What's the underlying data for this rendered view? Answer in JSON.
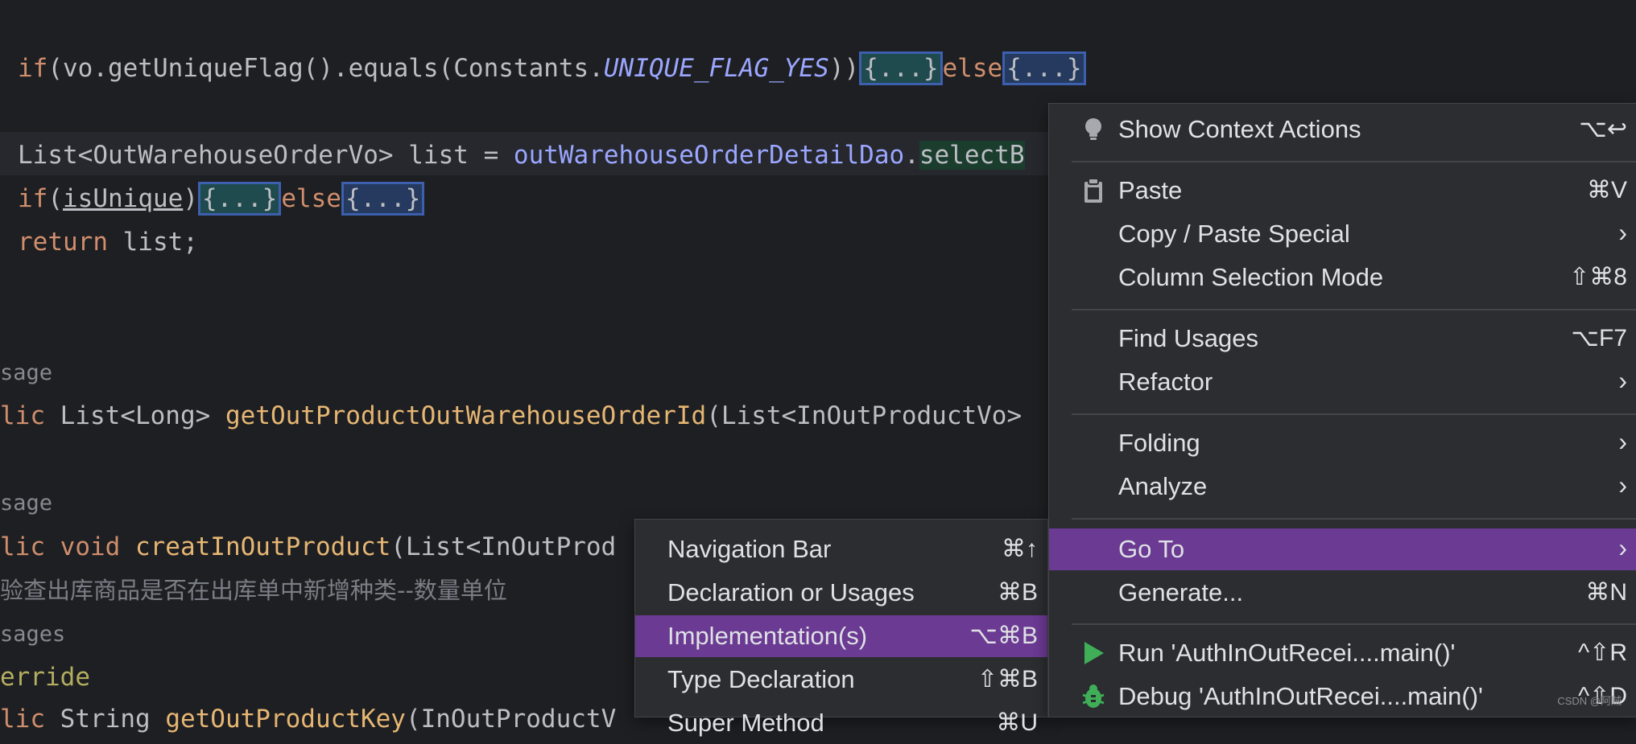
{
  "code": {
    "line1": {
      "if": "if",
      "a": "(vo.getUniqueFlag().equals(Constants.",
      "const": "UNIQUE_FLAG_YES",
      "b": "))",
      "fold1": "{...}",
      "else": "else",
      "fold2": "{...}"
    },
    "line2": {
      "a": "List<OutWarehouseOrderVo> list = ",
      "field": "outWarehouseOrderDetailDao",
      "dot": ".",
      "call": "selectB"
    },
    "line3": {
      "if": "if",
      "open": "(",
      "var": "isUnique",
      "close": ")",
      "fold1": "{...}",
      "else": "else",
      "fold2": "{...}"
    },
    "line4": {
      "ret": "return",
      "rest": " list;"
    },
    "usage1": "sage",
    "line5": {
      "kw": "lic",
      "a": " List<Long> ",
      "method": "getOutProductOutWarehouseOrderId",
      "b": "(List<InOutProductVo>"
    },
    "usage2": "sage",
    "line6": {
      "kw": "lic void",
      "sp": " ",
      "method": "creatInOutProduct",
      "b": "(List<InOutProd"
    },
    "comment": "验查出库商品是否在出库单中新增种类--数量单位",
    "usage3": "sages",
    "annotation": "erride",
    "line7": {
      "kw": "lic",
      "a": " String ",
      "method": "getOutProductKey",
      "b": "(InOutProductV"
    }
  },
  "context_menu": {
    "items": [
      {
        "label": "Show Context Actions",
        "shortcut": "⌥↩",
        "icon": "lightbulb-icon"
      },
      {
        "label": "Paste",
        "shortcut": "⌘V",
        "icon": "clipboard-icon"
      },
      {
        "label": "Copy / Paste Special",
        "arrow": "›"
      },
      {
        "label": "Column Selection Mode",
        "shortcut": "⇧⌘8"
      },
      {
        "label": "Find Usages",
        "shortcut": "⌥F7"
      },
      {
        "label": "Refactor",
        "arrow": "›"
      },
      {
        "label": "Folding",
        "arrow": "›"
      },
      {
        "label": "Analyze",
        "arrow": "›"
      },
      {
        "label": "Go To",
        "arrow": "›",
        "selected": true
      },
      {
        "label": "Generate...",
        "shortcut": "⌘N"
      },
      {
        "label": "Run 'AuthInOutRecei....main()'",
        "shortcut": "^⇧R",
        "icon": "run-icon"
      },
      {
        "label": "Debug 'AuthInOutRecei....main()'",
        "shortcut": "^⇧D",
        "icon": "debug-icon"
      }
    ]
  },
  "goto_submenu": {
    "items": [
      {
        "label": "Navigation Bar",
        "shortcut": "⌘↑"
      },
      {
        "label": "Declaration or Usages",
        "shortcut": "⌘B"
      },
      {
        "label": "Implementation(s)",
        "shortcut": "⌥⌘B",
        "selected": true
      },
      {
        "label": "Type Declaration",
        "shortcut": "⇧⌘B"
      },
      {
        "label": "Super Method",
        "shortcut": "⌘U"
      }
    ]
  },
  "colors": {
    "editor_bg": "#1e1f22",
    "menu_bg": "#2b2d30",
    "selection": "#6b3a93",
    "keyword": "#cf8e6d",
    "field": "#9ba6ff",
    "method": "#e6b673"
  },
  "watermark": "CSDN @阿贼"
}
